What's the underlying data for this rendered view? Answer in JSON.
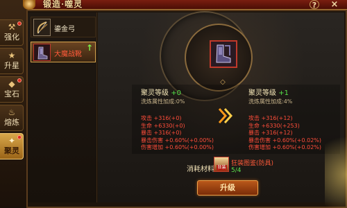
{
  "header": {
    "title": "锻造·噬灵",
    "help_label": "?",
    "close_label": "×"
  },
  "side_tabs": [
    {
      "label": "强化",
      "icon": "anvil-icon",
      "glyph": "⚒",
      "badge": true,
      "active": false
    },
    {
      "label": "升星",
      "icon": "star-icon",
      "glyph": "★",
      "badge": false,
      "active": false
    },
    {
      "label": "宝石",
      "icon": "gem-icon",
      "glyph": "◆",
      "badge": true,
      "active": false
    },
    {
      "label": "熔炼",
      "icon": "cauldron-icon",
      "glyph": "♨",
      "badge": false,
      "active": false
    },
    {
      "label": "聚灵",
      "icon": "spirit-icon",
      "glyph": "✦",
      "badge": true,
      "active": true
    }
  ],
  "items": [
    {
      "name": "鎏金弓",
      "icon": "bow-icon",
      "selected": false,
      "upgradable": false
    },
    {
      "name": "大魔战靴",
      "icon": "boots-icon",
      "selected": true,
      "upgradable": true
    }
  ],
  "current": {
    "level_label": "聚灵等级",
    "level_value": "+0",
    "wash_bonus": "洗炼属性加成:0%",
    "stats": [
      "攻击 +316(+0)",
      "生命 +6330(+0)",
      "暴击 +316(+0)",
      "暴击伤害 +0.60%(+0.00%)",
      "伤害增加 +0.60%(+0.00%)"
    ]
  },
  "next": {
    "level_label": "聚灵等级",
    "level_value": "+1",
    "wash_bonus": "洗炼属性加成:4%",
    "stats": [
      "攻击 +316(+12)",
      "生命 +6330(+253)",
      "暴击 +316(+12)",
      "暴击伤害 +0.60%(+0.02%)",
      "伤害增加 +0.60%(+0.02%)"
    ]
  },
  "material": {
    "label": "消耗材料:",
    "name": "狂装图鉴(防具)",
    "icon_text": "狂装",
    "count": "5/4"
  },
  "action": {
    "upgrade_label": "升级"
  },
  "colors": {
    "accent": "#d9a64e",
    "stat_red": "#ff4d3a",
    "level_green": "#56e24a",
    "panel_dark": "#1d140b"
  }
}
